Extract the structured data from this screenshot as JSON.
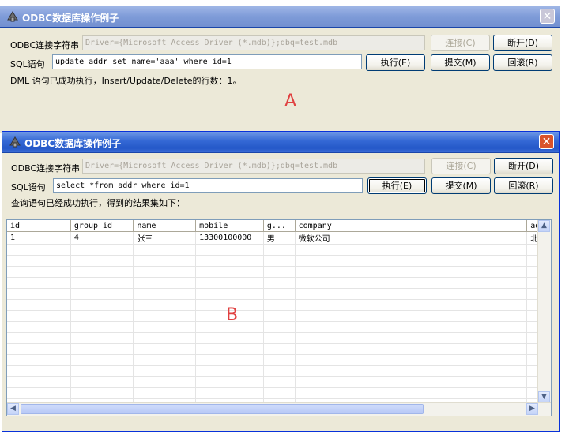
{
  "window_a": {
    "title": "ODBC数据库操作例子",
    "conn_label": "ODBC连接字符串",
    "conn_value": "Driver={Microsoft Access Driver (*.mdb)};dbq=test.mdb",
    "sql_label": "SQL语句",
    "sql_value": "update addr set name='aaa' where id=1",
    "connect_label": "连接(C)",
    "disconnect_label": "断开(D)",
    "execute_label": "执行(E)",
    "commit_label": "提交(M)",
    "rollback_label": "回滚(R)",
    "status": "DML 语句已成功执行，Insert/Update/Delete的行数：1。",
    "marker": "A"
  },
  "window_b": {
    "title": "ODBC数据库操作例子",
    "conn_label": "ODBC连接字符串",
    "conn_value": "Driver={Microsoft Access Driver (*.mdb)};dbq=test.mdb",
    "sql_label": "SQL语句",
    "sql_value": "select *from addr where id=1",
    "connect_label": "连接(C)",
    "disconnect_label": "断开(D)",
    "execute_label": "执行(E)",
    "commit_label": "提交(M)",
    "rollback_label": "回滚(R)",
    "status": "查询语句已经成功执行，得到的结果集如下：",
    "marker": "B",
    "grid": {
      "columns": [
        "id",
        "group_id",
        "name",
        "mobile",
        "g...",
        "company",
        "ad"
      ],
      "rows": [
        [
          "1",
          "4",
          "张三",
          "13300100000",
          "男",
          "微软公司",
          "北"
        ]
      ]
    }
  },
  "icons": {
    "app": "app-icon",
    "close": "close-icon"
  }
}
